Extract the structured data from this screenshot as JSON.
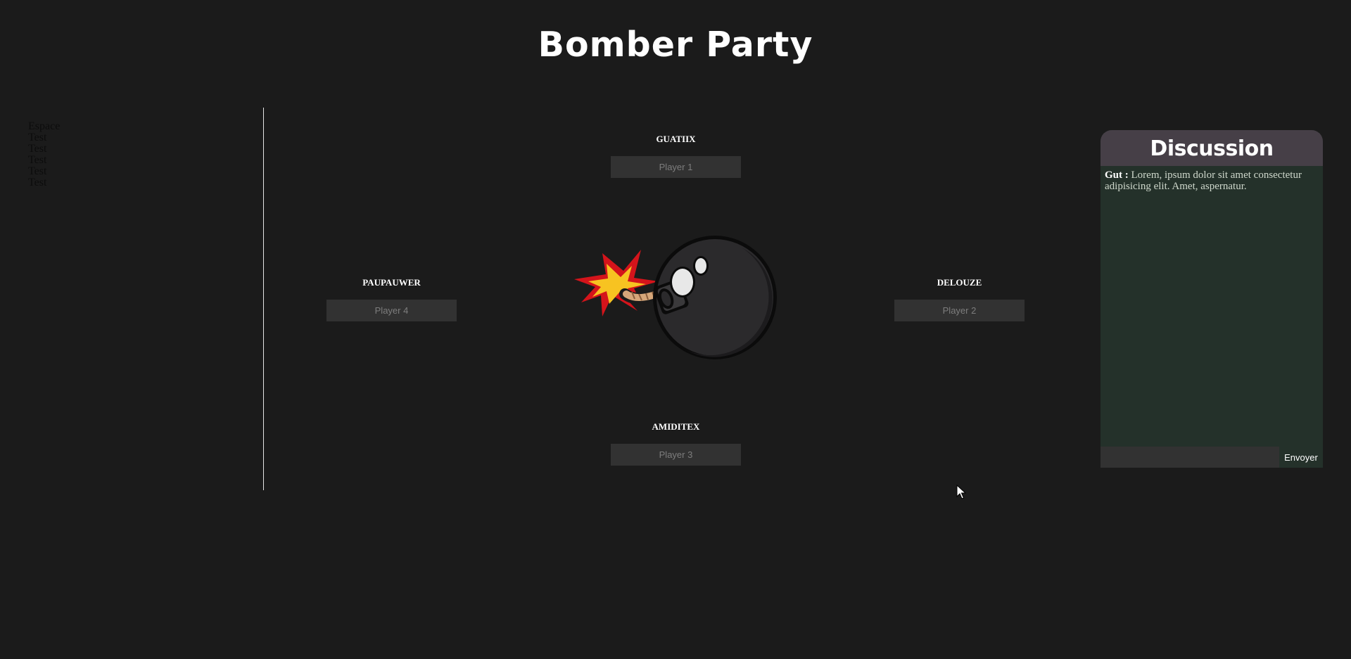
{
  "header": {
    "title": "Bomber Party"
  },
  "sidebar": {
    "items": [
      {
        "label": "Espace"
      },
      {
        "label": "Test"
      },
      {
        "label": "Test"
      },
      {
        "label": "Test"
      },
      {
        "label": "Test"
      },
      {
        "label": "Test"
      }
    ]
  },
  "players": [
    {
      "name": "GUATIIX",
      "placeholder": "Player 1"
    },
    {
      "name": "DELOUZE",
      "placeholder": "Player 2"
    },
    {
      "name": "AMIDITEX",
      "placeholder": "Player 3"
    },
    {
      "name": "PAUPAUWER",
      "placeholder": "Player 4"
    }
  ],
  "bomb": {
    "icon": "bomb-icon",
    "body_color": "#2b2a2c",
    "spark_color": "#f7c321"
  },
  "chat": {
    "title": "Discussion",
    "messages": [
      {
        "author": "Gut",
        "separator": " : ",
        "text": "Lorem, ipsum dolor sit amet consectetur adipisicing elit. Amet, aspernatur."
      }
    ],
    "input_value": "",
    "send_label": "Envoyer"
  },
  "colors": {
    "background": "#1b1b1b",
    "chat_header": "#463f47",
    "chat_body": "#24312a",
    "input": "#323232"
  }
}
